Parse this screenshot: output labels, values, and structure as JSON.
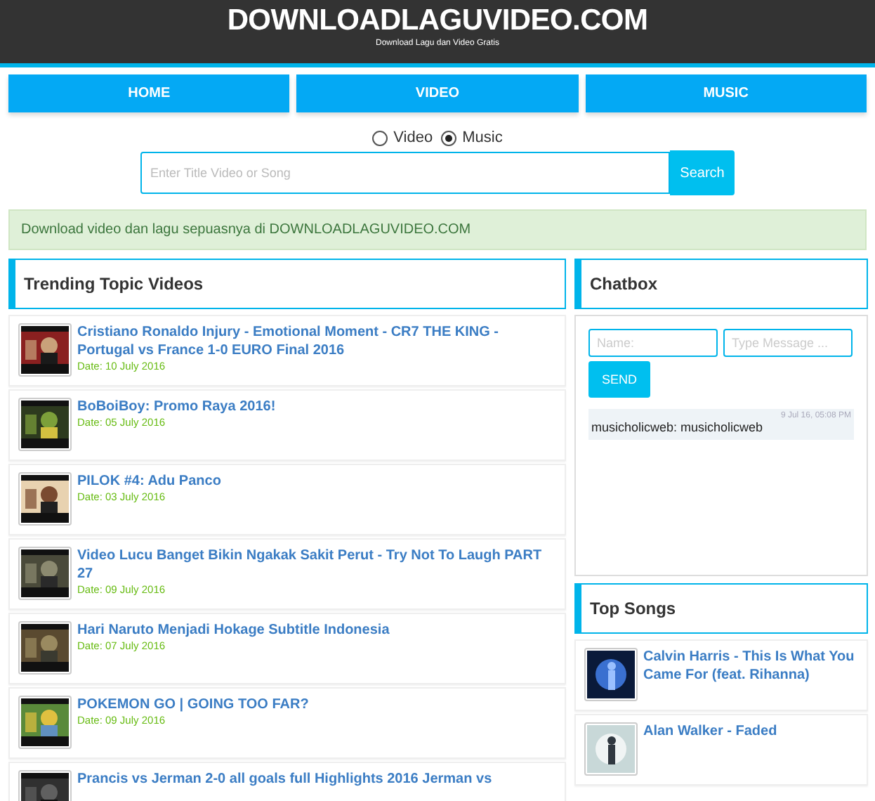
{
  "header": {
    "title": "DOWNLOADLAGUVIDEO.COM",
    "subtitle": "Download Lagu dan Video Gratis"
  },
  "nav": [
    "HOME",
    "VIDEO",
    "MUSIC"
  ],
  "search_type": [
    {
      "label": "Video",
      "selected": false
    },
    {
      "label": "Music",
      "selected": true
    }
  ],
  "search": {
    "placeholder": "Enter Title Video or Song",
    "button": "Search"
  },
  "notice": "Download video dan lagu sepuasnya di DOWNLOADLAGUVIDEO.COM",
  "trending": {
    "title": "Trending Topic Videos",
    "items": [
      {
        "title": "Cristiano Ronaldo Injury - Emotional Moment - CR7 THE KING - Portugal vs France 1-0 EURO Final 2016",
        "date": "Date: 10 July 2016"
      },
      {
        "title": "BoBoiBoy: Promo Raya 2016!",
        "date": "Date: 05 July 2016"
      },
      {
        "title": "PILOK #4: Adu Panco",
        "date": "Date: 03 July 2016"
      },
      {
        "title": "Video Lucu Banget Bikin Ngakak Sakit Perut - Try Not To Laugh PART 27",
        "date": "Date: 09 July 2016"
      },
      {
        "title": "Hari Naruto Menjadi Hokage Subtitle Indonesia",
        "date": "Date: 07 July 2016"
      },
      {
        "title": "POKEMON GO | GOING TOO FAR?",
        "date": "Date: 09 July 2016"
      },
      {
        "title": "Prancis vs Jerman 2-0 all goals full Highlights 2016 Jerman vs"
      }
    ]
  },
  "chatbox": {
    "title": "Chatbox",
    "name_placeholder": "Name:",
    "message_placeholder": "Type Message ...",
    "send": "SEND",
    "messages": [
      {
        "time": "9 Jul 16, 05:08 PM",
        "text": "musicholicweb: musicholicweb"
      }
    ]
  },
  "top_songs": {
    "title": "Top Songs",
    "items": [
      {
        "title": "Calvin Harris - This Is What You Came For (feat. Rihanna)"
      },
      {
        "title": "Alan Walker - Faded"
      }
    ]
  }
}
